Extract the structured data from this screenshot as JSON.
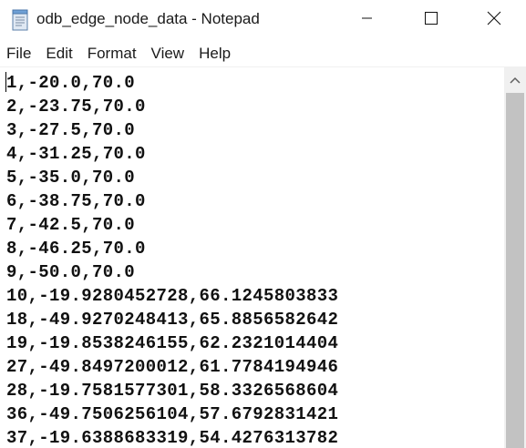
{
  "window": {
    "title": "odb_edge_node_data - Notepad"
  },
  "menu": {
    "items": [
      "File",
      "Edit",
      "Format",
      "View",
      "Help"
    ]
  },
  "editor": {
    "lines": [
      "1,-20.0,70.0",
      "2,-23.75,70.0",
      "3,-27.5,70.0",
      "4,-31.25,70.0",
      "5,-35.0,70.0",
      "6,-38.75,70.0",
      "7,-42.5,70.0",
      "8,-46.25,70.0",
      "9,-50.0,70.0",
      "10,-19.9280452728,66.1245803833",
      "18,-49.9270248413,65.8856582642",
      "19,-19.8538246155,62.2321014404",
      "27,-49.8497200012,61.7784194946",
      "28,-19.7581577301,58.3326568604",
      "36,-49.7506256104,57.6792831421",
      "37,-19.6388683319,54.4276313782"
    ]
  },
  "icons": {
    "app": "notepad-icon",
    "minimize": "minimize-icon",
    "maximize": "maximize-icon",
    "close": "close-icon",
    "scroll_up": "scroll-up-arrow-icon"
  },
  "colors": {
    "scrollbar_track": "#f0f0f0",
    "scrollbar_thumb": "#c2c2c2",
    "text": "#111111"
  }
}
